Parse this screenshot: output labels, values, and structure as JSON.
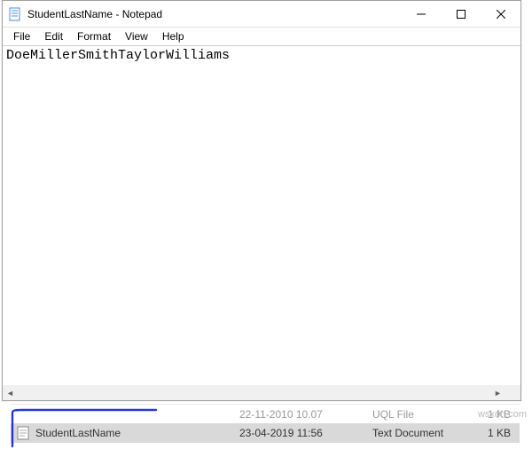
{
  "window": {
    "title": "StudentLastName - Notepad"
  },
  "menu": {
    "file": "File",
    "edit": "Edit",
    "format": "Format",
    "view": "View",
    "help": "Help"
  },
  "content": {
    "text": "DoeMillerSmithTaylorWilliams"
  },
  "explorer": {
    "partial_row": {
      "date": "22-11-2010 10.07",
      "type": "UQL File",
      "size": "1 KB"
    },
    "selected_row": {
      "name": "StudentLastName",
      "date": "23-04-2019 11:56",
      "type": "Text Document",
      "size": "1 KB"
    }
  },
  "watermark": "wsxdn.com"
}
